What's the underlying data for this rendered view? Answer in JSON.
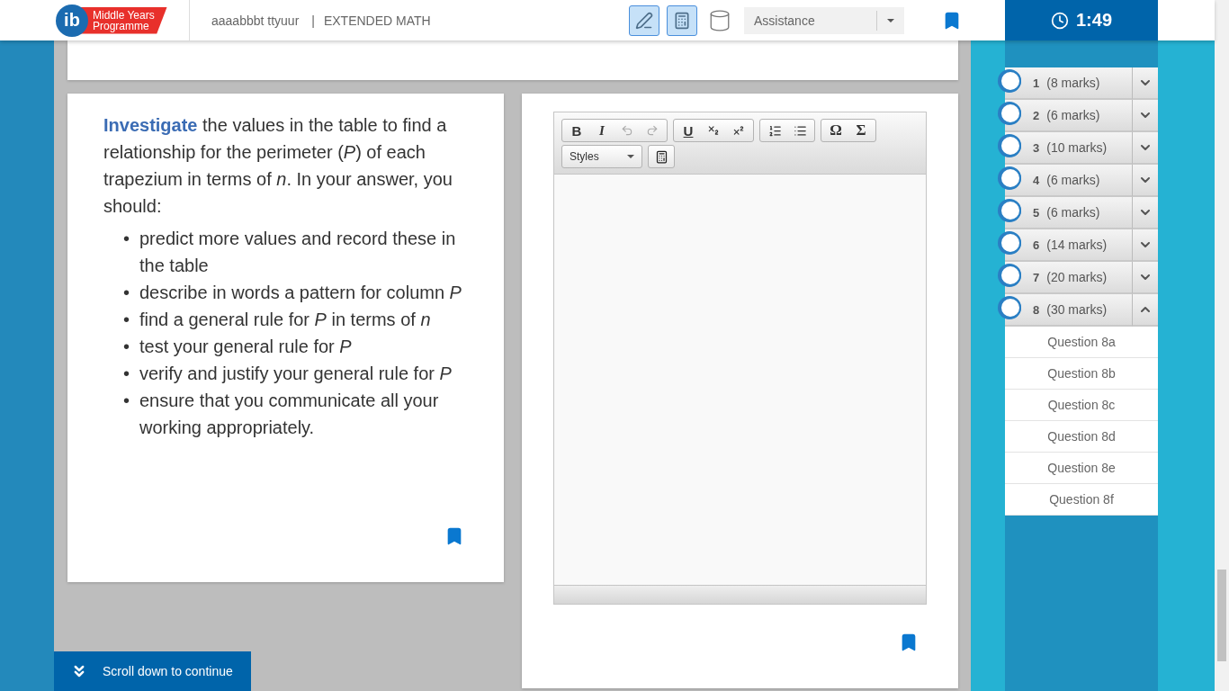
{
  "header": {
    "logo": {
      "mark": "ib",
      "line1": "Middle Years",
      "line2": "Programme"
    },
    "student": "aaaabbbt ttyuur",
    "separator": "|",
    "subject": "EXTENDED MATH",
    "tools": [
      {
        "kind": "pen",
        "selected": true
      },
      {
        "kind": "calculator",
        "selected": true
      },
      {
        "kind": "cylinder",
        "selected": false
      }
    ],
    "assistance": {
      "value": "Assistance"
    },
    "timer": "1:49"
  },
  "question": {
    "prompt": "**Investigate** the values in the table to find a relationship for the perimeter (*P*) of each trapezium in terms of *n*. In your answer, you should:",
    "marker": "•",
    "bullets": [
      "predict more values and record these in the table",
      "describe in words a pattern for column *P*",
      "find a general rule for *P* in terms of *n*",
      "test your general rule for *P*",
      "verify and justify your general rule for *P*",
      "ensure that you communicate all your working appropriately."
    ]
  },
  "editor": {
    "toolbar": [
      [
        {
          "kind": "bold",
          "label": "B",
          "disabled": false
        },
        {
          "kind": "italic",
          "label": "I",
          "disabled": false
        },
        {
          "kind": "undo",
          "disabled": true
        },
        {
          "kind": "redo",
          "disabled": true
        }
      ],
      [
        {
          "kind": "underline",
          "label": "U",
          "disabled": false
        },
        {
          "kind": "subscript",
          "disabled": false
        },
        {
          "kind": "superscript",
          "disabled": false
        }
      ],
      [
        {
          "kind": "ordered-list",
          "disabled": false
        },
        {
          "kind": "bullet-list",
          "disabled": false
        }
      ],
      [
        {
          "kind": "symbol",
          "label": "Ω",
          "disabled": false
        },
        {
          "kind": "symbol",
          "label": "Σ",
          "disabled": false
        }
      ]
    ],
    "styles": "Styles"
  },
  "scroll_hint": "Scroll down to continue",
  "questions": [
    {
      "number": "1",
      "marks": "(8 marks)",
      "expanded": false
    },
    {
      "number": "2",
      "marks": "(6 marks)",
      "expanded": false
    },
    {
      "number": "3",
      "marks": "(10 marks)",
      "expanded": false
    },
    {
      "number": "4",
      "marks": "(6 marks)",
      "expanded": false
    },
    {
      "number": "5",
      "marks": "(6 marks)",
      "expanded": false
    },
    {
      "number": "6",
      "marks": "(14 marks)",
      "expanded": false
    },
    {
      "number": "7",
      "marks": "(20 marks)",
      "expanded": false
    },
    {
      "number": "8",
      "marks": "(30 marks)",
      "expanded": true,
      "children": [
        "Question 8a",
        "Question 8b",
        "Question 8c",
        "Question 8d",
        "Question 8e",
        "Question 8f"
      ]
    }
  ]
}
